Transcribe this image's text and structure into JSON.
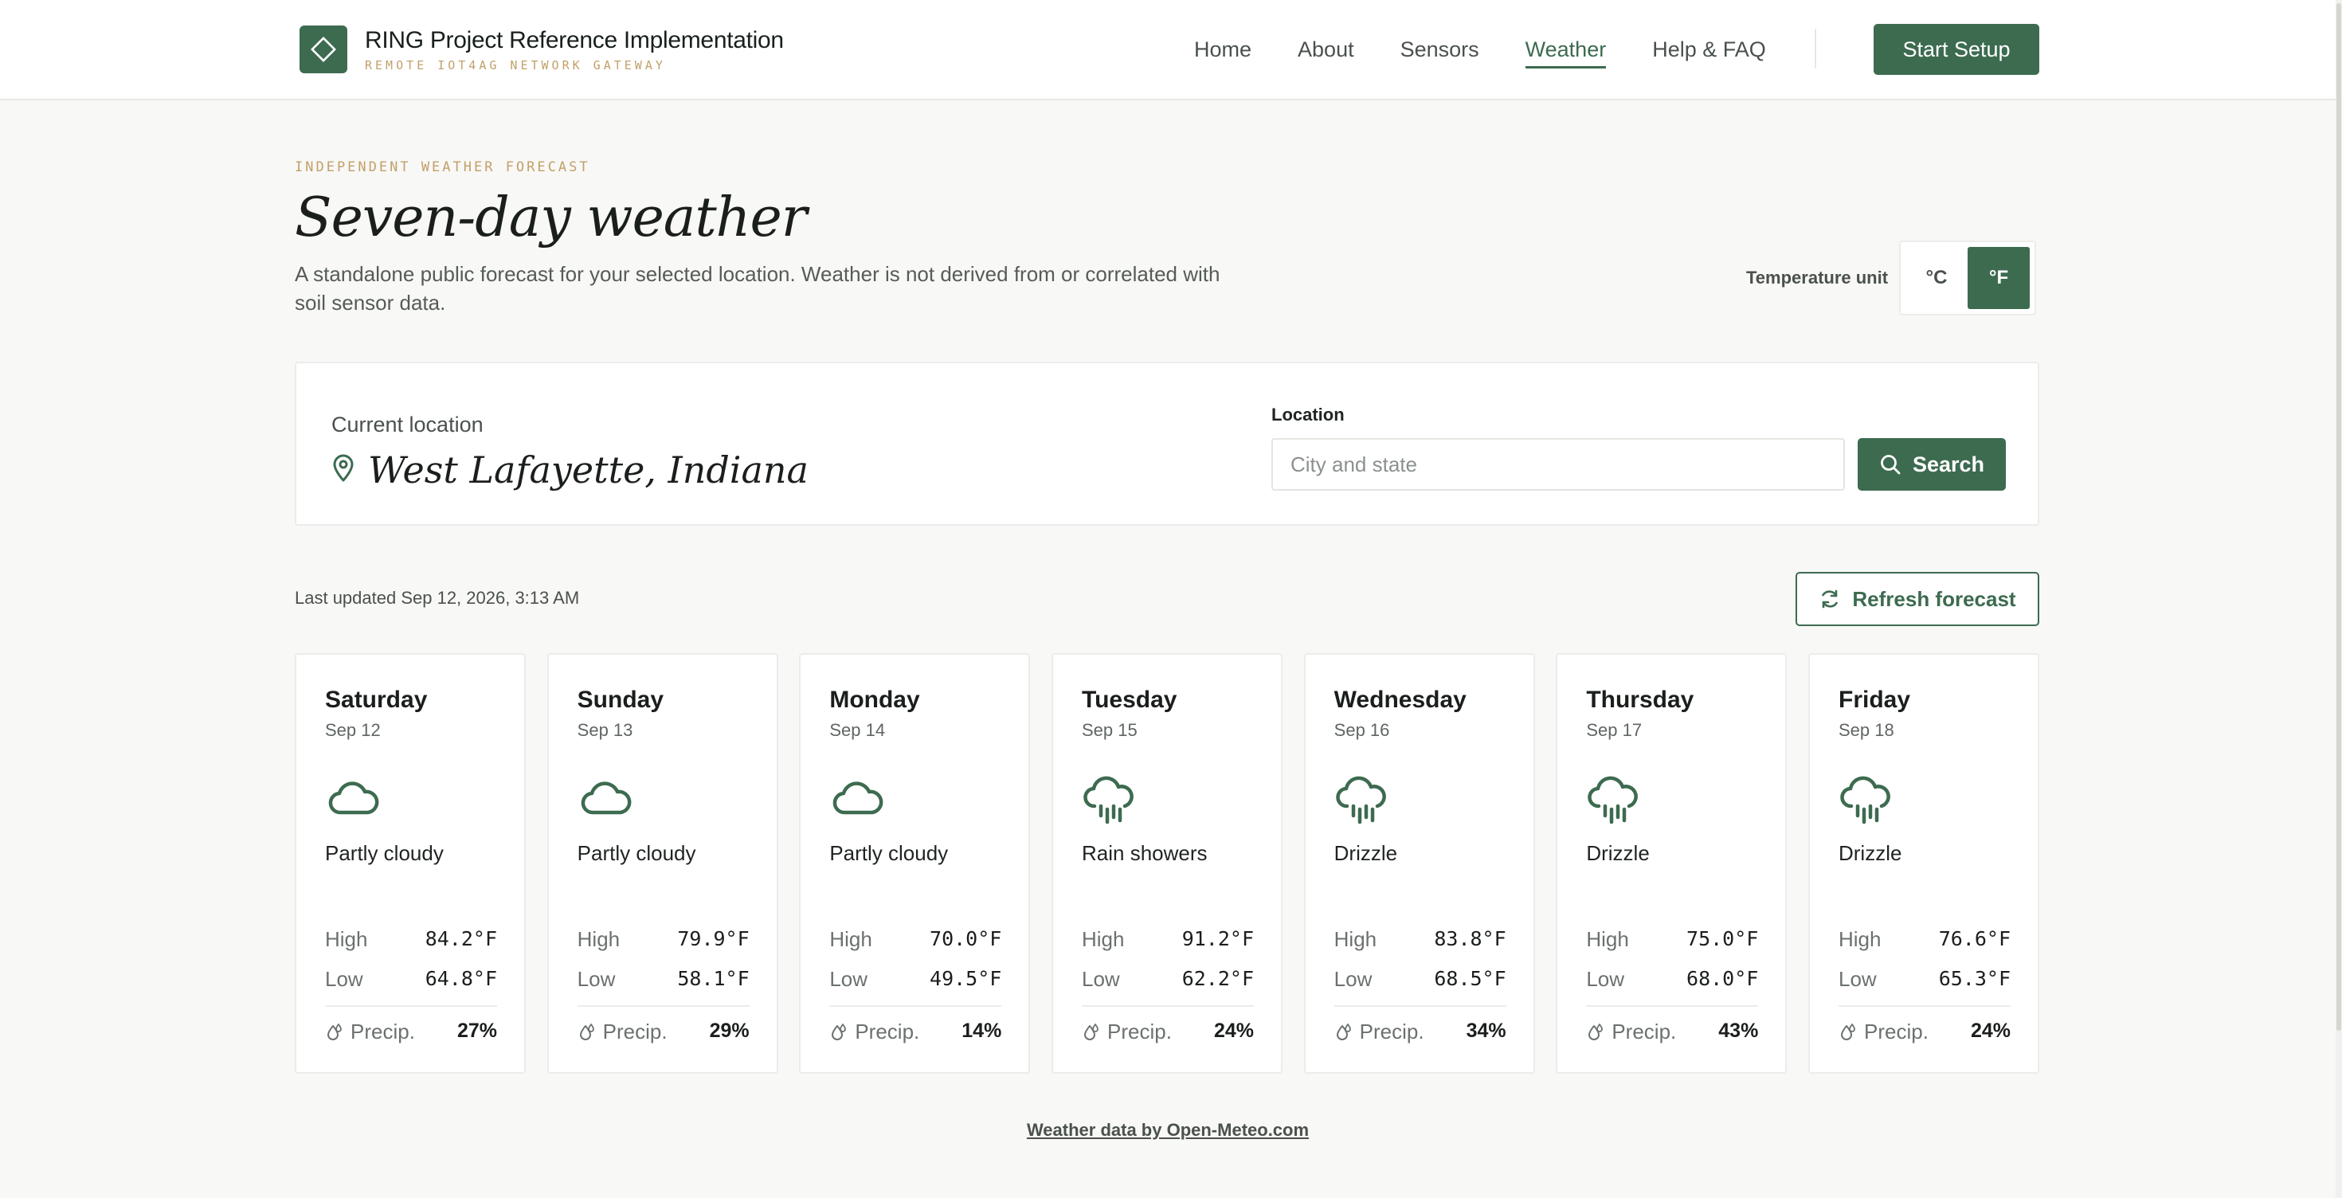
{
  "brand": {
    "title": "RING Project Reference Implementation",
    "subtitle": "REMOTE IOT4AG NETWORK GATEWAY",
    "logo_icon": "diamond-logo-icon"
  },
  "nav": {
    "items": [
      "Home",
      "About",
      "Sensors",
      "Weather",
      "Help & FAQ"
    ],
    "active": "Weather",
    "cta_label": "Start Setup"
  },
  "hero": {
    "eyebrow": "INDEPENDENT WEATHER FORECAST",
    "title": "Seven-day weather",
    "description": "A standalone public forecast for your selected location. Weather is not derived from or correlated with soil sensor data."
  },
  "unit_toggle": {
    "label": "Temperature unit",
    "options": [
      "°C",
      "°F"
    ],
    "selected": "°F"
  },
  "location": {
    "current_label": "Current location",
    "current_value": "West Lafayette, Indiana",
    "field_label": "Location",
    "placeholder": "City and state",
    "input_value": "",
    "search_label": "Search"
  },
  "status": {
    "last_updated": "Last updated Sep 12, 2026, 3:13 AM",
    "refresh_label": "Refresh forecast"
  },
  "labels": {
    "high": "High",
    "low": "Low",
    "precip": "Precip."
  },
  "forecast": [
    {
      "day": "Saturday",
      "date": "Sep 12",
      "icon": "cloud-icon",
      "condition": "Partly cloudy",
      "high": "84.2°F",
      "low": "64.8°F",
      "precip": "27%"
    },
    {
      "day": "Sunday",
      "date": "Sep 13",
      "icon": "cloud-icon",
      "condition": "Partly cloudy",
      "high": "79.9°F",
      "low": "58.1°F",
      "precip": "29%"
    },
    {
      "day": "Monday",
      "date": "Sep 14",
      "icon": "cloud-icon",
      "condition": "Partly cloudy",
      "high": "70.0°F",
      "low": "49.5°F",
      "precip": "14%"
    },
    {
      "day": "Tuesday",
      "date": "Sep 15",
      "icon": "rain-cloud-icon",
      "condition": "Rain showers",
      "high": "91.2°F",
      "low": "62.2°F",
      "precip": "24%"
    },
    {
      "day": "Wednesday",
      "date": "Sep 16",
      "icon": "rain-cloud-icon",
      "condition": "Drizzle",
      "high": "83.8°F",
      "low": "68.5°F",
      "precip": "34%"
    },
    {
      "day": "Thursday",
      "date": "Sep 17",
      "icon": "rain-cloud-icon",
      "condition": "Drizzle",
      "high": "75.0°F",
      "low": "68.0°F",
      "precip": "43%"
    },
    {
      "day": "Friday",
      "date": "Sep 18",
      "icon": "rain-cloud-icon",
      "condition": "Drizzle",
      "high": "76.6°F",
      "low": "65.3°F",
      "precip": "24%"
    }
  ],
  "footer": {
    "credit": "Weather data by Open-Meteo.com"
  },
  "colors": {
    "accent": "#3d6b50",
    "eyebrow": "#c2a06a",
    "background": "#f8f8f6"
  }
}
